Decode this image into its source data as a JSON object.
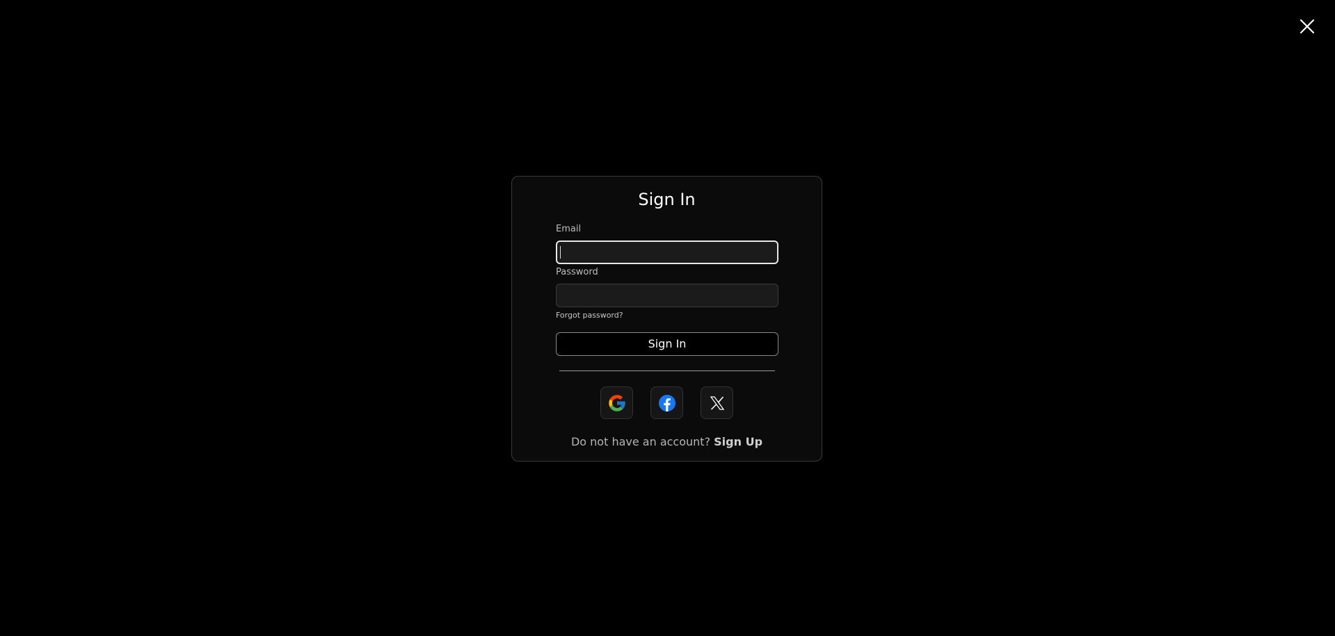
{
  "close": {
    "icon": "close-icon"
  },
  "signin": {
    "title": "Sign In",
    "email": {
      "label": "Email",
      "value": "",
      "placeholder": ""
    },
    "password": {
      "label": "Password",
      "value": "",
      "placeholder": ""
    },
    "forgot_label": "Forgot password?",
    "submit_label": "Sign In",
    "social": [
      {
        "name": "google",
        "icon": "google-icon"
      },
      {
        "name": "facebook",
        "icon": "facebook-icon"
      },
      {
        "name": "x",
        "icon": "x-icon"
      }
    ],
    "footer_text": "Do not have an account?",
    "signup_label": "Sign Up"
  },
  "colors": {
    "background": "#000000",
    "card": "#0b0b0b",
    "input": "#1b1b1b",
    "facebook": "#1877f2"
  }
}
